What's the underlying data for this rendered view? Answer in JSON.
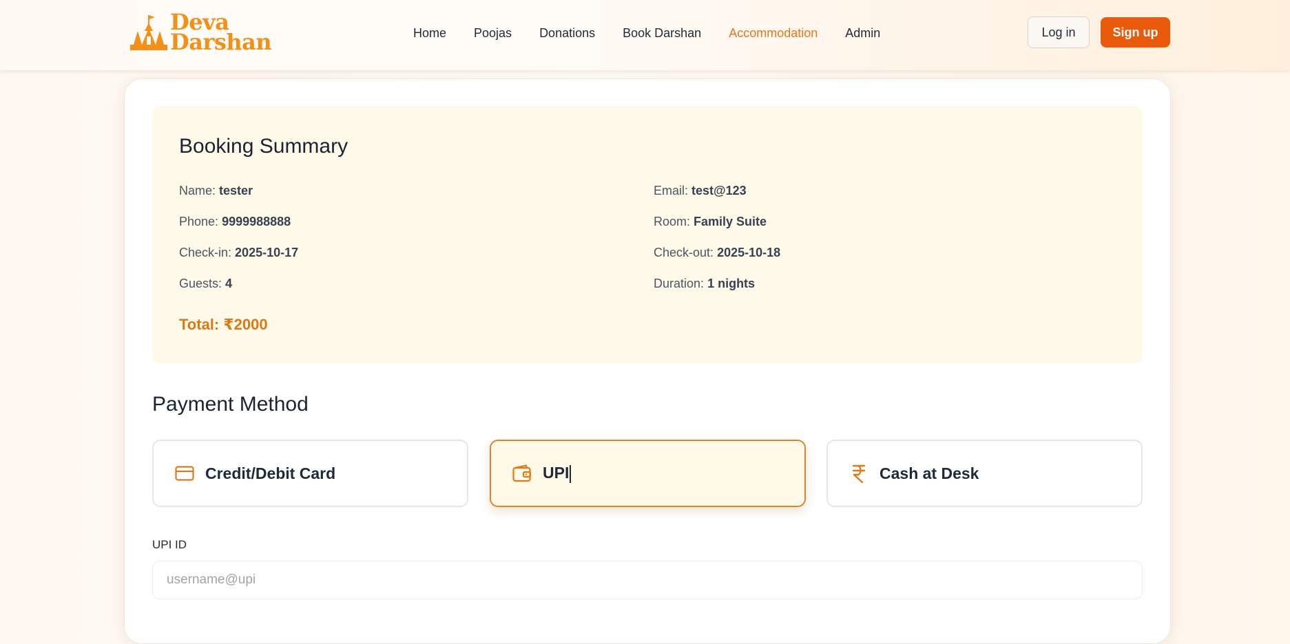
{
  "header": {
    "logo": {
      "line1": "Deva",
      "line2": "Darshan",
      "icon": "temple-icon"
    },
    "nav": [
      {
        "label": "Home"
      },
      {
        "label": "Poojas"
      },
      {
        "label": "Donations"
      },
      {
        "label": "Book Darshan"
      },
      {
        "label": "Accommodation",
        "active": true
      },
      {
        "label": "Admin"
      }
    ],
    "login_label": "Log in",
    "signup_label": "Sign up"
  },
  "summary": {
    "title": "Booking Summary",
    "name_label": "Name:",
    "name": "tester",
    "email_label": "Email:",
    "email": "test@123",
    "phone_label": "Phone:",
    "phone": "9999988888",
    "room_label": "Room:",
    "room": "Family Suite",
    "checkin_label": "Check-in:",
    "checkin": "2025-10-17",
    "checkout_label": "Check-out:",
    "checkout": "2025-10-18",
    "guests_label": "Guests:",
    "guests": "4",
    "duration_label": "Duration:",
    "duration": "1 nights",
    "total": "Total: ₹2000"
  },
  "payment": {
    "title": "Payment Method",
    "options": [
      {
        "label": "Credit/Debit Card",
        "icon": "credit-card-icon"
      },
      {
        "label": "UPI",
        "icon": "wallet-icon",
        "selected": true
      },
      {
        "label": "Cash at Desk",
        "icon": "rupee-icon"
      }
    ],
    "upi_label": "UPI ID",
    "upi_placeholder": "username@upi",
    "upi_value": ""
  },
  "colors": {
    "accent": "#ea5a0c",
    "active_nav": "#e8761c",
    "total": "#d97a14",
    "summary_bg": "#fef9e8",
    "selected_border": "#d9862b"
  }
}
